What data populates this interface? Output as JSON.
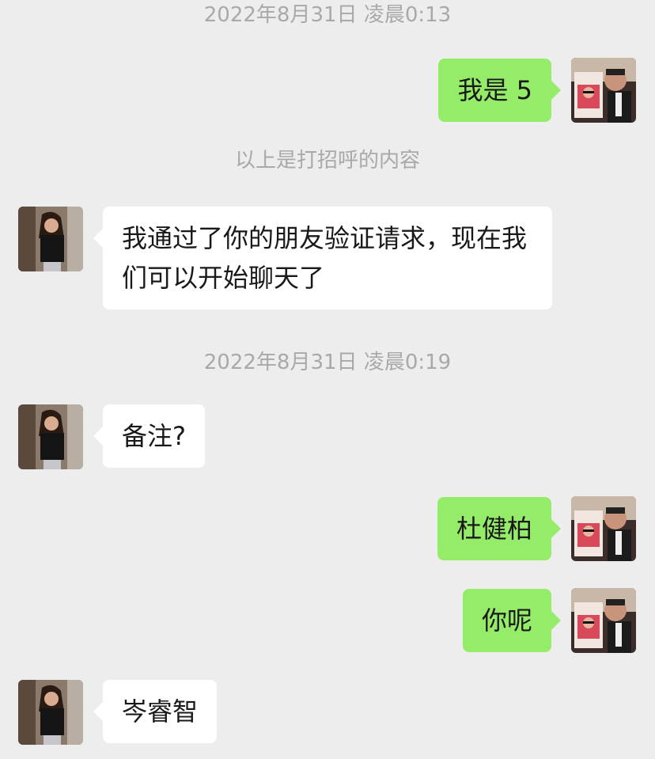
{
  "messages": [
    {
      "type": "timestamp",
      "text": "2022年8月31日 凌晨0:13"
    },
    {
      "type": "sent",
      "text": "我是 5"
    },
    {
      "type": "system",
      "text": "以上是打招呼的内容"
    },
    {
      "type": "received",
      "text": "我通过了你的朋友验证请求，现在我们可以开始聊天了"
    },
    {
      "type": "timestamp",
      "text": "2022年8月31日 凌晨0:19"
    },
    {
      "type": "received",
      "text": "备注?"
    },
    {
      "type": "sent",
      "text": "杜健柏"
    },
    {
      "type": "sent",
      "text": "你呢"
    },
    {
      "type": "received",
      "text": "岑睿智"
    }
  ],
  "colors": {
    "background": "#ededed",
    "sent_bubble": "#95ec69",
    "received_bubble": "#ffffff",
    "meta_text": "#a9a9a9"
  }
}
